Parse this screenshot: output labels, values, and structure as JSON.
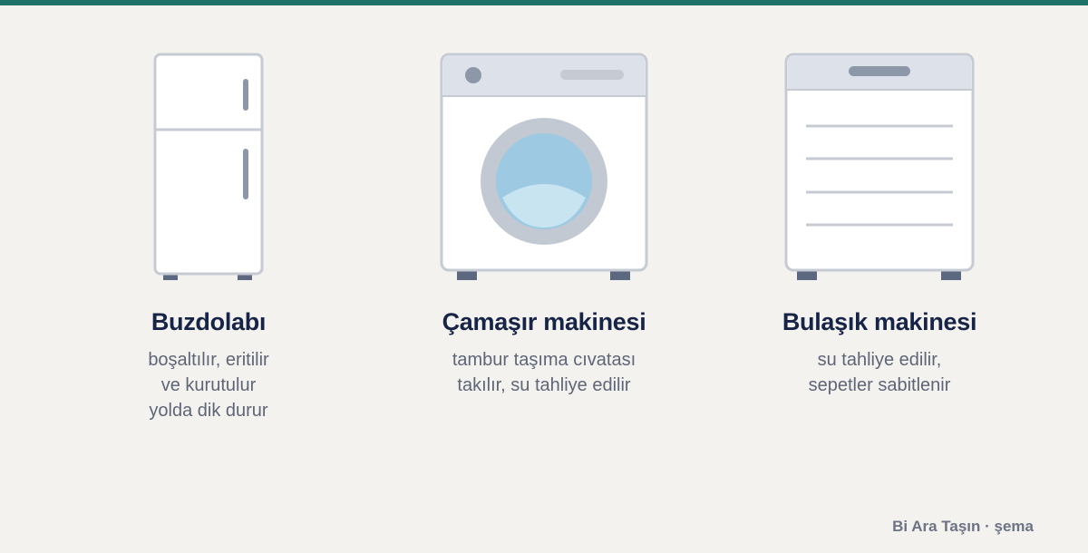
{
  "accent_color": "#1d7368",
  "items": [
    {
      "icon": "fridge-icon",
      "title": "Buzdolabı",
      "lines": [
        "boşaltılır, eritilir",
        "ve kurutulur",
        "yolda dik durur"
      ]
    },
    {
      "icon": "washing-machine-icon",
      "title": "Çamaşır makinesi",
      "lines": [
        "tambur taşıma cıvatası",
        "takılır, su tahliye edilir"
      ]
    },
    {
      "icon": "dishwasher-icon",
      "title": "Bulaşık makinesi",
      "lines": [
        "su tahliye edilir,",
        "sepetler sabitlenir"
      ]
    }
  ],
  "footer": "Bi Ara Taşın · şema"
}
